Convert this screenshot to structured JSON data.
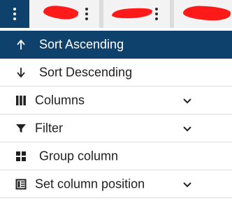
{
  "header": {
    "menu_icon": "kebab-vertical-icon",
    "column_menu_icon": "kebab-vertical-icon"
  },
  "menu": {
    "items": [
      {
        "label": "Sort Ascending",
        "icon": "arrow-up-icon",
        "active": true
      },
      {
        "label": "Sort Descending",
        "icon": "arrow-down-icon"
      },
      {
        "label": "Columns",
        "icon": "columns-icon",
        "expandable": true
      },
      {
        "label": "Filter",
        "icon": "filter-icon",
        "expandable": true
      },
      {
        "label": "Group column",
        "icon": "group-grid-icon"
      },
      {
        "label": "Set column position",
        "icon": "column-position-icon",
        "expandable": true
      }
    ]
  },
  "colors": {
    "accent": "#0e416c",
    "redaction": "#ff1a1a"
  }
}
